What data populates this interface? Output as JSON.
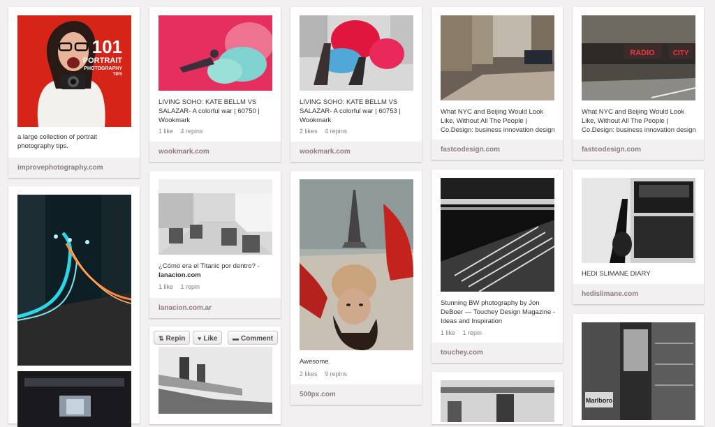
{
  "pins": [
    {
      "id": "p1",
      "desc": "a large collection of portrait photography tips.",
      "source": "improvephotography.com",
      "image_text": {
        "big": "101",
        "line1": "PORTRAIT",
        "line2": "PHOTOGRAPHY",
        "line3": "TIPS"
      }
    },
    {
      "id": "p2",
      "desc": "",
      "source": ""
    },
    {
      "id": "p3",
      "desc": "LIVING SOHO: KATE BELLM VS SALAZAR- A colorful war | 60750 | Wookmark",
      "likes": "1 like",
      "repins": "4 repins",
      "source": "wookmark.com"
    },
    {
      "id": "p4",
      "desc": "¿Cómo era el Titanic por dentro? -",
      "desc_bold": "lanacion.com",
      "likes": "1 like",
      "repins": "1 repin",
      "source": "lanacion.com.ar"
    },
    {
      "id": "p5",
      "desc": "",
      "source": ""
    },
    {
      "id": "p6",
      "desc": "LIVING SOHO: KATE BELLM VS SALAZAR- A colorful war | 60753 | Wookmark",
      "likes": "2 likes",
      "repins": "4 repins",
      "source": "wookmark.com"
    },
    {
      "id": "p7",
      "desc": "Awesome.",
      "likes": "2 likes",
      "repins": "9 repins",
      "source": "500px.com"
    },
    {
      "id": "p8",
      "desc": "What NYC and Beijing Would Look Like, Without All The People | Co.Design: business innovation design",
      "source": "fastcodesign.com"
    },
    {
      "id": "p9",
      "desc": "Stunning BW photography by Jon DeBoer — Touchey Design Magazine - Ideas and Inspiration",
      "likes": "1 like",
      "repins": "1 repin",
      "source": "touchey.com"
    },
    {
      "id": "p10",
      "desc": "",
      "source": ""
    },
    {
      "id": "p11",
      "desc": "What NYC and Beijing Would Look Like, Without All The People | Co.Design: business innovation design",
      "source": "fastcodesign.com",
      "image_text": {
        "sign1": "RADIO",
        "sign2": "CITY"
      }
    },
    {
      "id": "p12",
      "desc": "HEDI SLIMANE DIARY",
      "source": "hedislimane.com"
    },
    {
      "id": "p13",
      "desc": "",
      "source": "",
      "image_text": {
        "sign1": "Marlboro"
      }
    }
  ],
  "hover_actions": {
    "repin": "Repin",
    "like": "Like",
    "comment": "Comment"
  },
  "icons": {
    "repin": "repin-icon",
    "like": "heart-icon",
    "comment": "speech-bubble-icon"
  }
}
